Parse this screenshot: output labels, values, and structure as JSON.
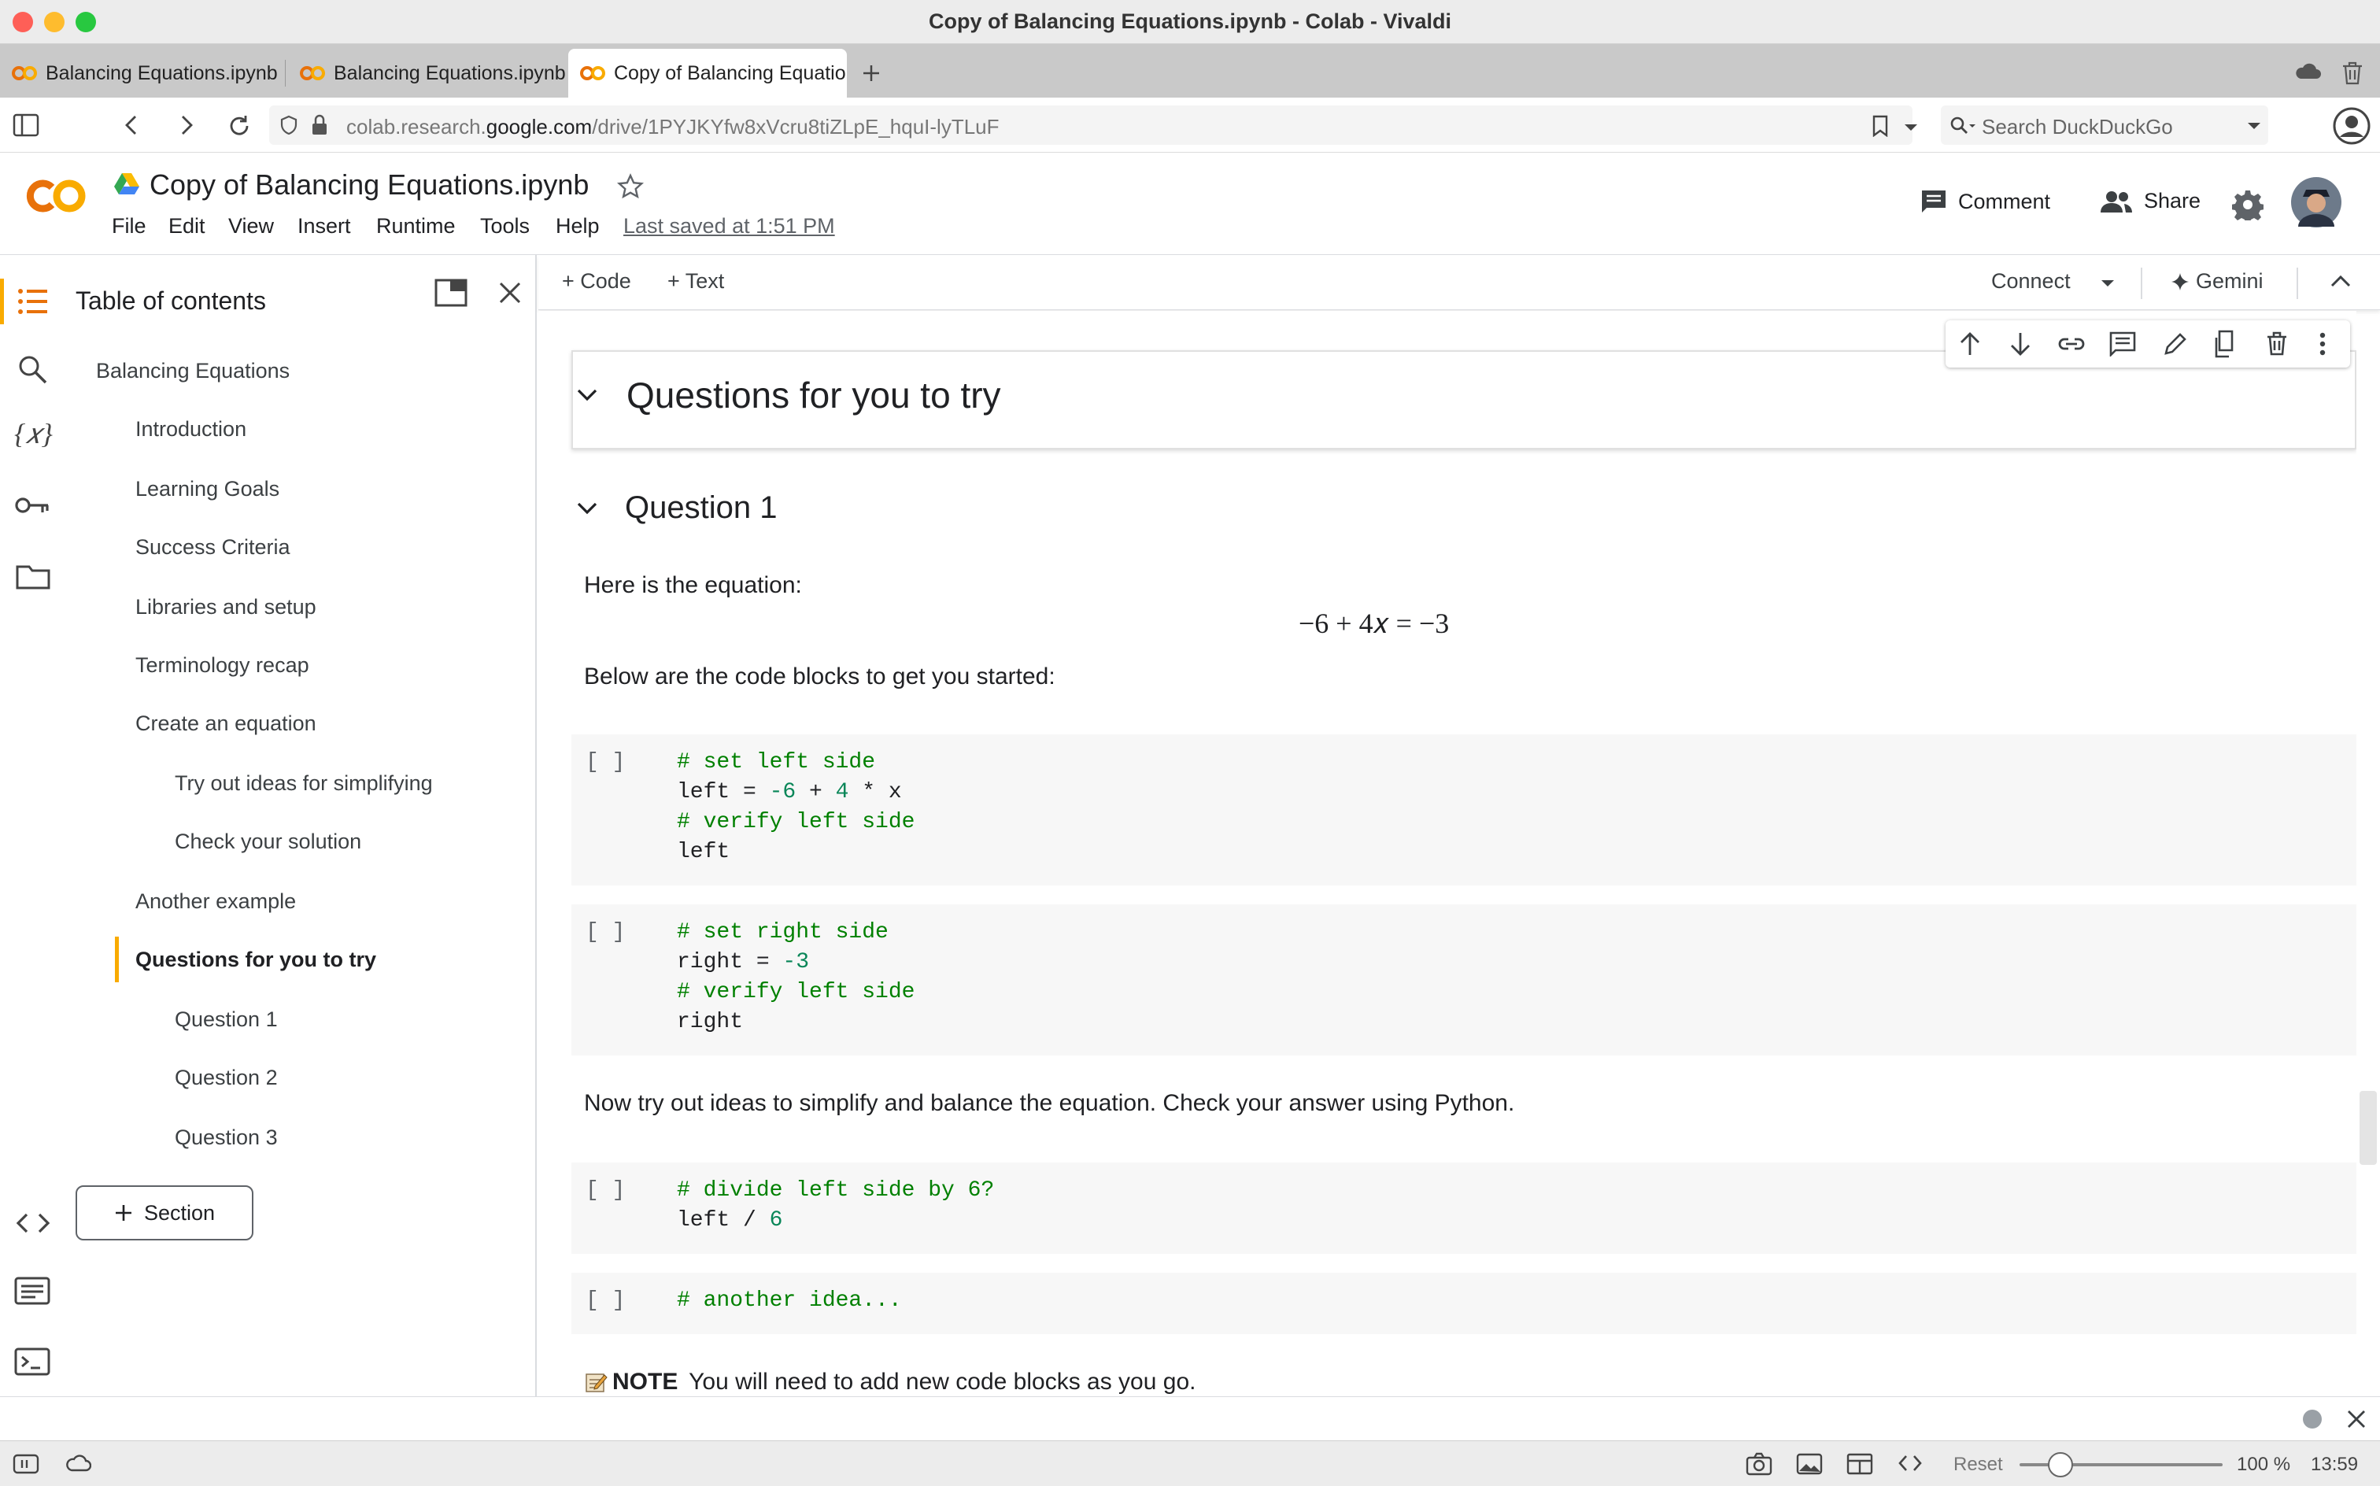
{
  "window": {
    "title": "Copy of Balancing Equations.ipynb - Colab - Vivaldi"
  },
  "tabs": [
    {
      "label": "Balancing Equations.ipynb"
    },
    {
      "label": "Balancing Equations.ipynb"
    },
    {
      "label": "Copy of Balancing Equatio"
    }
  ],
  "address": {
    "url_prefix": "colab.research.",
    "url_domain": "google.com",
    "url_path": "/drive/1PYJKYfw8xVcru8tiZLpE_hquI-lyTLuF",
    "search_placeholder": "Search DuckDuckGo"
  },
  "colab": {
    "notebook_title": "Copy of Balancing Equations.ipynb",
    "menu": [
      "File",
      "Edit",
      "View",
      "Insert",
      "Runtime",
      "Tools",
      "Help"
    ],
    "last_saved": "Last saved at 1:51 PM",
    "comment_label": "Comment",
    "share_label": "Share"
  },
  "toc": {
    "title": "Table of contents",
    "items": [
      {
        "label": "Balancing Equations",
        "level": 1
      },
      {
        "label": "Introduction",
        "level": 2
      },
      {
        "label": "Learning Goals",
        "level": 2
      },
      {
        "label": "Success Criteria",
        "level": 2
      },
      {
        "label": "Libraries and setup",
        "level": 2
      },
      {
        "label": "Terminology recap",
        "level": 2
      },
      {
        "label": "Create an equation",
        "level": 2
      },
      {
        "label": "Try out ideas for simplifying",
        "level": 3
      },
      {
        "label": "Check your solution",
        "level": 3
      },
      {
        "label": "Another example",
        "level": 2
      },
      {
        "label": "Questions for you to try",
        "level": 2,
        "active": true
      },
      {
        "label": "Question 1",
        "level": 3
      },
      {
        "label": "Question 2",
        "level": 3
      },
      {
        "label": "Question 3",
        "level": 3
      }
    ],
    "section_button": "Section"
  },
  "toolbar": {
    "add_code": "Code",
    "add_text": "Text",
    "connect": "Connect",
    "gemini": "Gemini"
  },
  "content": {
    "heading_questions": "Questions for you to try",
    "heading_q1": "Question 1",
    "intro_text": "Here is the equation:",
    "equation": "−6 + 4𝑥 = −3",
    "below_text": "Below are the code blocks to get you started:",
    "cell1": {
      "bracket": "[ ]",
      "line1": "# set left side",
      "line2_a": "left = ",
      "line2_n1": "-6",
      "line2_b": " + ",
      "line2_n2": "4",
      "line2_c": " * x",
      "line3": "# verify left side",
      "line4": "left"
    },
    "cell2": {
      "bracket": "[ ]",
      "line1": "# set right side",
      "line2_a": "right = ",
      "line2_n1": "-3",
      "line3": "# verify left side",
      "line4": "right"
    },
    "try_text": "Now try out ideas to simplify and balance the equation. Check your answer using Python.",
    "cell3": {
      "bracket": "[ ]",
      "line1": "# divide left side by 6?",
      "line2_a": "left / ",
      "line2_n1": "6"
    },
    "cell4": {
      "bracket": "[ ]",
      "line1": "# another idea..."
    },
    "note_bold": "NOTE",
    "note_text": " You will need to add new code blocks as you go."
  },
  "status": {
    "reset": "Reset",
    "zoom": "100 %",
    "time": "13:59",
    "zoom_level": 0.2
  },
  "colors": {
    "accent": "#f9ab00",
    "code_comment": "#008000",
    "code_number": "#098658",
    "code_bg": "#f7f7f7"
  }
}
